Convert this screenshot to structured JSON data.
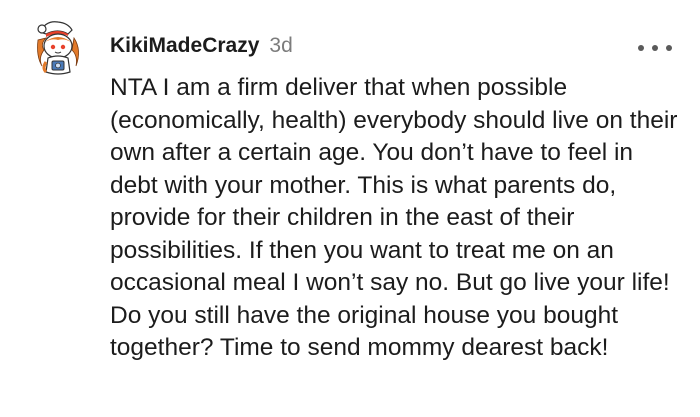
{
  "comment": {
    "username": "KikiMadeCrazy",
    "timestamp": "3d",
    "avatar_icon": "snoo-avatar-icon",
    "more_icon": "more-options-icon",
    "body": "NTA I am a firm deliver that when possible (economically, health) everybody should live on their own after a certain age. You don’t have to feel in debt with your mother. This is what parents do, provide for their children in the east of their possibilities. If then you want to treat me on an occasional meal I won’t say no. But go live your life! Do you still have the original house you bought together? Time to send mommy dearest back!"
  },
  "colors": {
    "text": "#1c1c1c",
    "muted": "#7c7c7c",
    "background": "#ffffff"
  }
}
